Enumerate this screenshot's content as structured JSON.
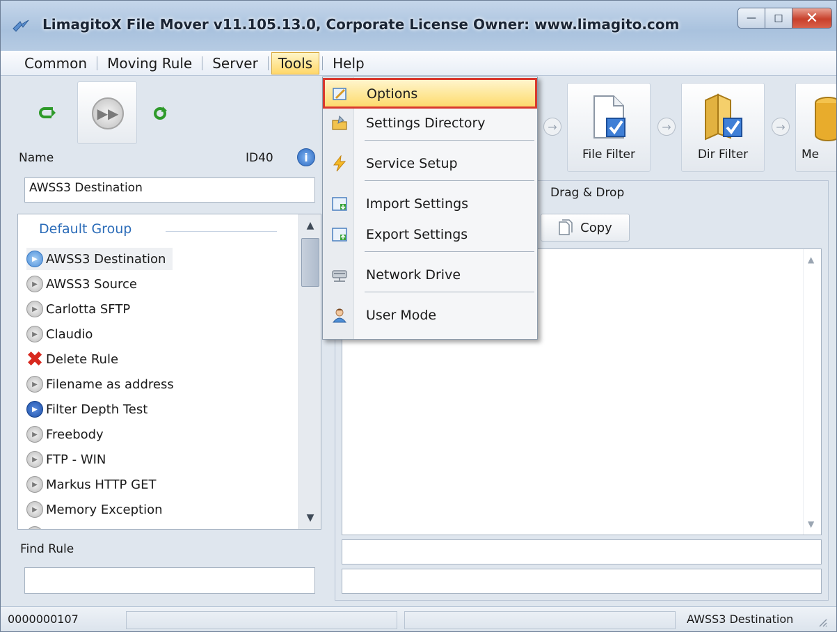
{
  "window": {
    "title": "LimagitoX File Mover v11.105.13.0, Corporate License Owner: www.limagito.com",
    "controls": {
      "minimize": "—",
      "maximize": "□",
      "close": "✕"
    }
  },
  "menubar": {
    "items": [
      {
        "label": "Common"
      },
      {
        "label": "Moving Rule"
      },
      {
        "label": "Server"
      },
      {
        "label": "Tools",
        "active": true
      },
      {
        "label": "Help"
      }
    ]
  },
  "rule_panel": {
    "name_label": "Name",
    "id_label": "ID40",
    "name_value": "AWSS3 Destination",
    "group_header": "Default Group",
    "rules": [
      {
        "label": "AWSS3 Destination",
        "icon": "rule-active-icon",
        "selected": true
      },
      {
        "label": "AWSS3 Source",
        "icon": "rule-icon"
      },
      {
        "label": "Carlotta SFTP",
        "icon": "rule-icon"
      },
      {
        "label": "Claudio",
        "icon": "rule-icon"
      },
      {
        "label": "Delete Rule",
        "icon": "delete-x-icon"
      },
      {
        "label": "Filename as address",
        "icon": "rule-icon"
      },
      {
        "label": "Filter Depth Test",
        "icon": "rule-running-icon"
      },
      {
        "label": "Freebody",
        "icon": "rule-icon"
      },
      {
        "label": "FTP - WIN",
        "icon": "rule-icon"
      },
      {
        "label": "Markus HTTP GET",
        "icon": "rule-icon"
      },
      {
        "label": "Memory Exception",
        "icon": "rule-icon"
      }
    ],
    "find_label": "Find Rule",
    "find_value": ""
  },
  "flow": {
    "buttons": [
      {
        "label": "File Filter",
        "icon": "file-filter-icon"
      },
      {
        "label": "Dir Filter",
        "icon": "dir-filter-icon"
      },
      {
        "label": "Me",
        "icon": "database-icon"
      }
    ]
  },
  "workspace": {
    "drag_drop_label": "Drag & Drop",
    "copy_label": "Copy",
    "text_value": "",
    "field1_value": "",
    "field2_value": ""
  },
  "tools_menu": {
    "items": [
      {
        "label": "Options",
        "icon": "options-icon",
        "highlighted": true
      },
      {
        "label": "Settings Directory",
        "icon": "settings-directory-icon"
      },
      {
        "label": "Service Setup",
        "icon": "service-setup-icon"
      },
      {
        "label": "Import Settings",
        "icon": "import-settings-icon"
      },
      {
        "label": "Export Settings",
        "icon": "export-settings-icon"
      },
      {
        "label": "Network Drive",
        "icon": "network-drive-icon"
      },
      {
        "label": "User Mode",
        "icon": "user-mode-icon"
      }
    ]
  },
  "statusbar": {
    "counter": "0000000107",
    "rule_name": "AWSS3 Destination"
  },
  "colors": {
    "accent_highlight": "#fddb6d",
    "highlight_outline": "#d9392d",
    "group_header": "#2a6bb8",
    "close_button": "#c8402b"
  }
}
